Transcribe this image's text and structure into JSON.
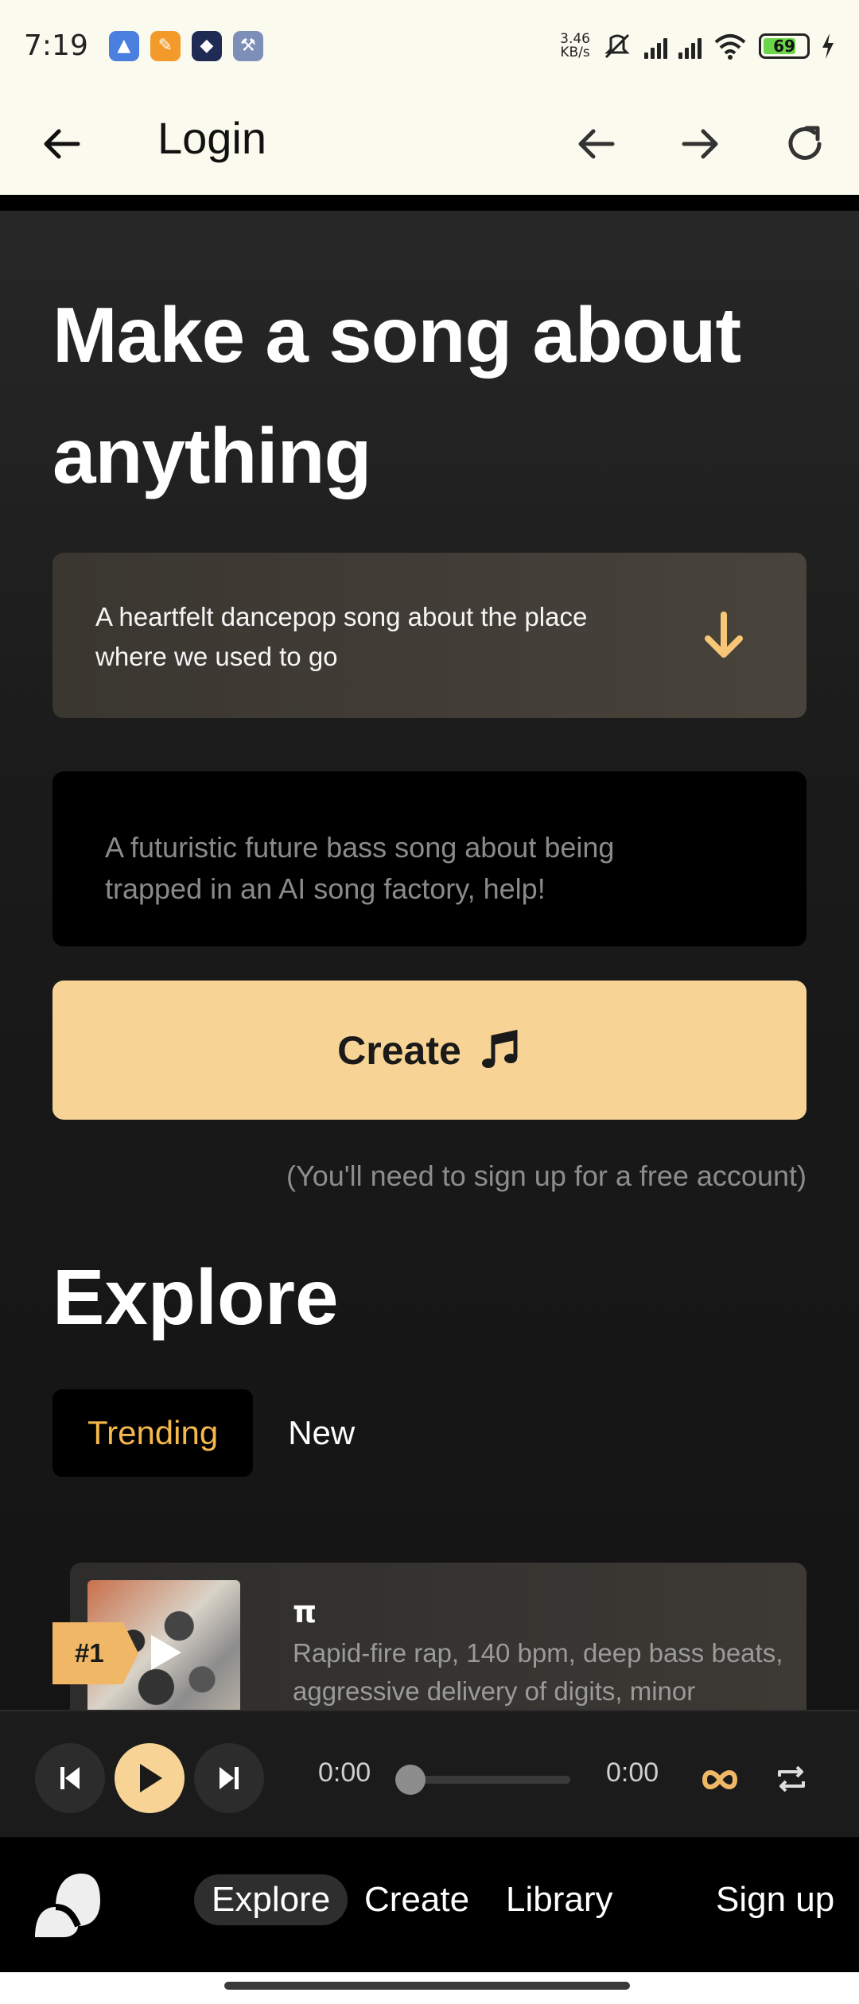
{
  "status_bar": {
    "time": "7:19",
    "net_speed_value": "3.46",
    "net_speed_unit": "KB/s",
    "battery": "69"
  },
  "app_bar": {
    "title": "Login"
  },
  "hero": {
    "title": "Make a song about anything"
  },
  "prompt_suggestion": {
    "text": "A heartfelt dancepop song about the place where we used to go"
  },
  "prompt_input": {
    "placeholder": "A futuristic future bass song about being trapped in an AI song factory, help!"
  },
  "create_button": {
    "label": "Create"
  },
  "signup_note": "(You'll need to sign up for a free account)",
  "explore": {
    "title": "Explore",
    "tabs": [
      {
        "label": "Trending",
        "active": true
      },
      {
        "label": "New",
        "active": false
      }
    ],
    "songs": [
      {
        "rank": "#1",
        "title": "π",
        "description": "Rapid-fire rap, 140 bpm, deep bass beats, aggressive delivery of digits, minor"
      }
    ]
  },
  "player": {
    "current_time": "0:00",
    "total_time": "0:00",
    "progress": 0
  },
  "bottom_nav": {
    "items": [
      {
        "label": "Explore",
        "active": true
      },
      {
        "label": "Create",
        "active": false
      },
      {
        "label": "Library",
        "active": false
      }
    ],
    "signup": "Sign up"
  },
  "colors": {
    "accent": "#f7d496",
    "tab_active_text": "#f5b84a",
    "rank_badge": "#f0b866",
    "app_bar_bg": "#fbfaee"
  }
}
